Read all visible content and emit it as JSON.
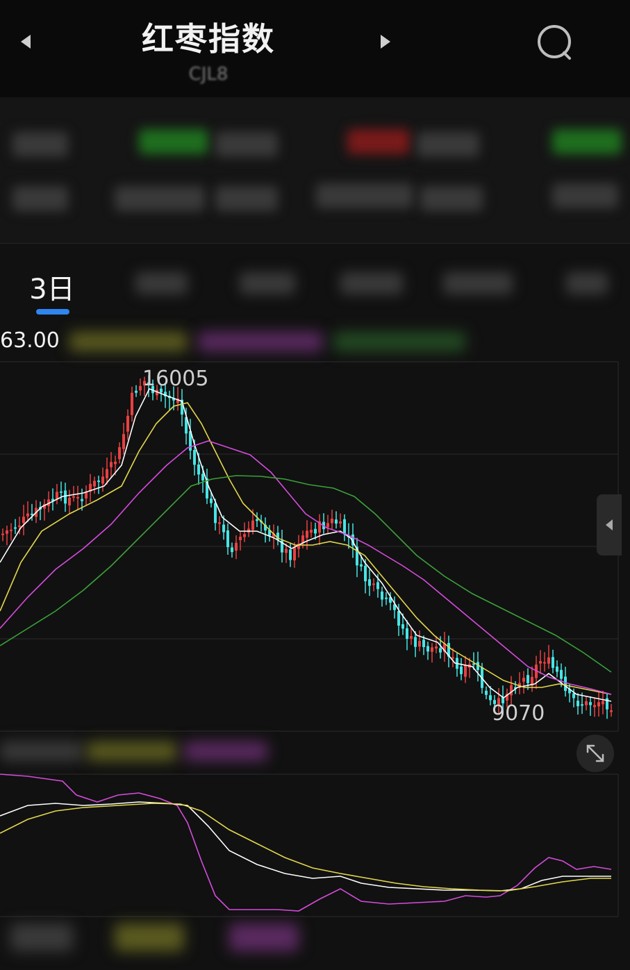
{
  "header": {
    "title": "红枣指数",
    "subtitle": "CJL8",
    "prev_icon": "triangle-left-icon",
    "next_icon": "triangle-right-icon",
    "search_icon": "search-icon"
  },
  "period_tabs": {
    "active_label": "3日",
    "accent_color": "#2e86f0"
  },
  "main_chart": {
    "price_label": "63.00",
    "high_annotation": "16005",
    "low_annotation": "9070",
    "colors": {
      "up": "#e84142",
      "down": "#47e5e5",
      "ma_white": "#ffffff",
      "ma_yellow": "#e4d84c",
      "ma_magenta": "#d64cdd",
      "ma_green": "#3ba13b",
      "grid": "#2c2c2c"
    }
  },
  "sub_chart": {
    "colors": {
      "white": "#ffffff",
      "yellow": "#e4d84c",
      "magenta": "#d64cdd"
    }
  },
  "icons": {
    "collapse_panel": "chevron-left-icon",
    "expand": "expand-arrows-icon"
  }
}
